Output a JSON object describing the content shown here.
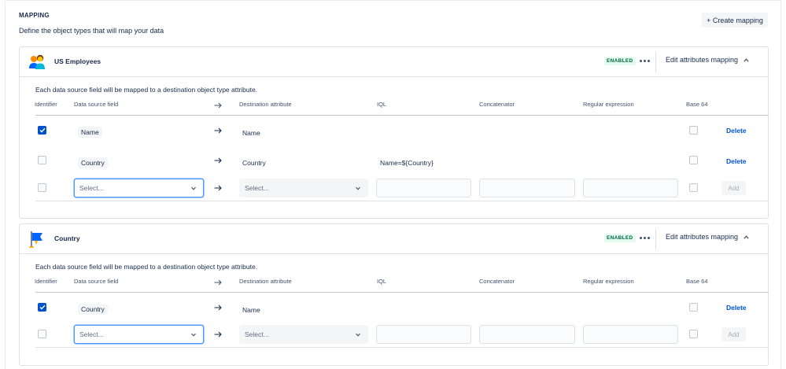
{
  "section": {
    "title": "MAPPING",
    "description": "Define the object types that will map your data",
    "create_label": "+ Create mapping"
  },
  "columns": {
    "identifier": "Identifier",
    "source": "Data source field",
    "destination": "Destination attribute",
    "iql": "IQL",
    "concatenator": "Concatenator",
    "regex": "Regular expression",
    "base64": "Base 64"
  },
  "cards": [
    {
      "title": "US Employees",
      "icon": "people-icon",
      "status": "ENABLED",
      "edit_label": "Edit attributes mapping",
      "note": "Each data source field will be mapped to a destination object type attribute.",
      "rows": [
        {
          "identifier": true,
          "source": "Name",
          "destination": "Name",
          "iql": "",
          "delete": "Delete"
        },
        {
          "identifier": false,
          "source": "Country",
          "destination": "Country",
          "iql": "Name=${Country}",
          "delete": "Delete"
        }
      ],
      "new_row": {
        "source_placeholder": "Select...",
        "destination_placeholder": "Select...",
        "add": "Add"
      }
    },
    {
      "title": "Country",
      "icon": "flag-icon",
      "status": "ENABLED",
      "edit_label": "Edit attributes mapping",
      "note": "Each data source field will be mapped to a destination object type attribute.",
      "rows": [
        {
          "identifier": true,
          "source": "Country",
          "destination": "Name",
          "iql": "",
          "delete": "Delete"
        }
      ],
      "new_row": {
        "source_placeholder": "Select...",
        "destination_placeholder": "Select...",
        "add": "Add"
      }
    }
  ],
  "colors": {
    "primary": "#0052cc",
    "enabled_bg": "#e3fcef",
    "enabled_text": "#006644"
  }
}
